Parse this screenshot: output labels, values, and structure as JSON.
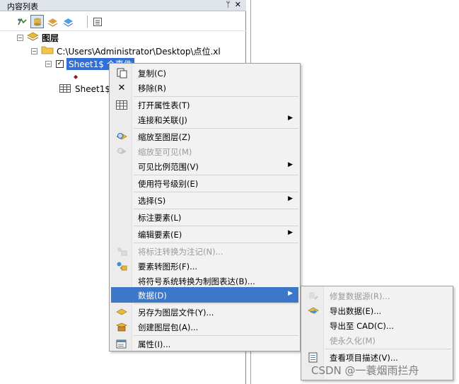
{
  "toc": {
    "title": "内容列表",
    "pin_glyph": "ᛘ",
    "close_glyph": "✕",
    "tree": {
      "layers_label": "图层",
      "file_path": "C:\\Users\\Administrator\\Desktop\\点位.xl",
      "selected_layer": "Sheet1$ 个事件",
      "table_item": "Sheet1$"
    }
  },
  "context_menu": {
    "items": [
      {
        "label": "复制(C)",
        "icon": "copy-icon"
      },
      {
        "label": "移除(R)",
        "icon": "remove-icon"
      },
      {
        "label": "打开属性表(T)",
        "icon": "table-icon"
      },
      {
        "label": "连接和关联(J)",
        "submenu": true
      },
      {
        "label": "缩放至图层(Z)",
        "icon": "zoom-to-layer-icon"
      },
      {
        "label": "缩放至可见(M)",
        "icon": "zoom-visible-icon",
        "disabled": true
      },
      {
        "label": "可见比例范围(V)",
        "submenu": true
      },
      {
        "label": "使用符号级别(E)"
      },
      {
        "label": "选择(S)",
        "submenu": true
      },
      {
        "label": "标注要素(L)"
      },
      {
        "label": "编辑要素(E)",
        "submenu": true
      },
      {
        "label": "将标注转换为注记(N)...",
        "icon": "convert-labels-icon",
        "disabled": true
      },
      {
        "label": "要素转图形(F)...",
        "icon": "features-to-graphics-icon"
      },
      {
        "label": "将符号系统转换为制图表达(B)..."
      },
      {
        "label": "数据(D)",
        "submenu": true,
        "highlighted": true
      },
      {
        "label": "另存为图层文件(Y)...",
        "icon": "save-layer-icon"
      },
      {
        "label": "创建图层包(A)...",
        "icon": "layer-package-icon"
      },
      {
        "label": "属性(I)...",
        "icon": "properties-icon"
      }
    ]
  },
  "data_submenu": {
    "items": [
      {
        "label": "修复数据源(R)...",
        "disabled": true
      },
      {
        "label": "导出数据(E)..."
      },
      {
        "label": "导出至 CAD(C)..."
      },
      {
        "label": "使永久化(M)",
        "disabled": true
      },
      {
        "label": "查看项目描述(V)..."
      }
    ]
  },
  "watermark": "CSDN @一蓑烟雨拦舟",
  "colors": {
    "highlight": "#3c77c9",
    "selection": "#2f6fd6",
    "menu_bg": "#f2f2f2"
  }
}
